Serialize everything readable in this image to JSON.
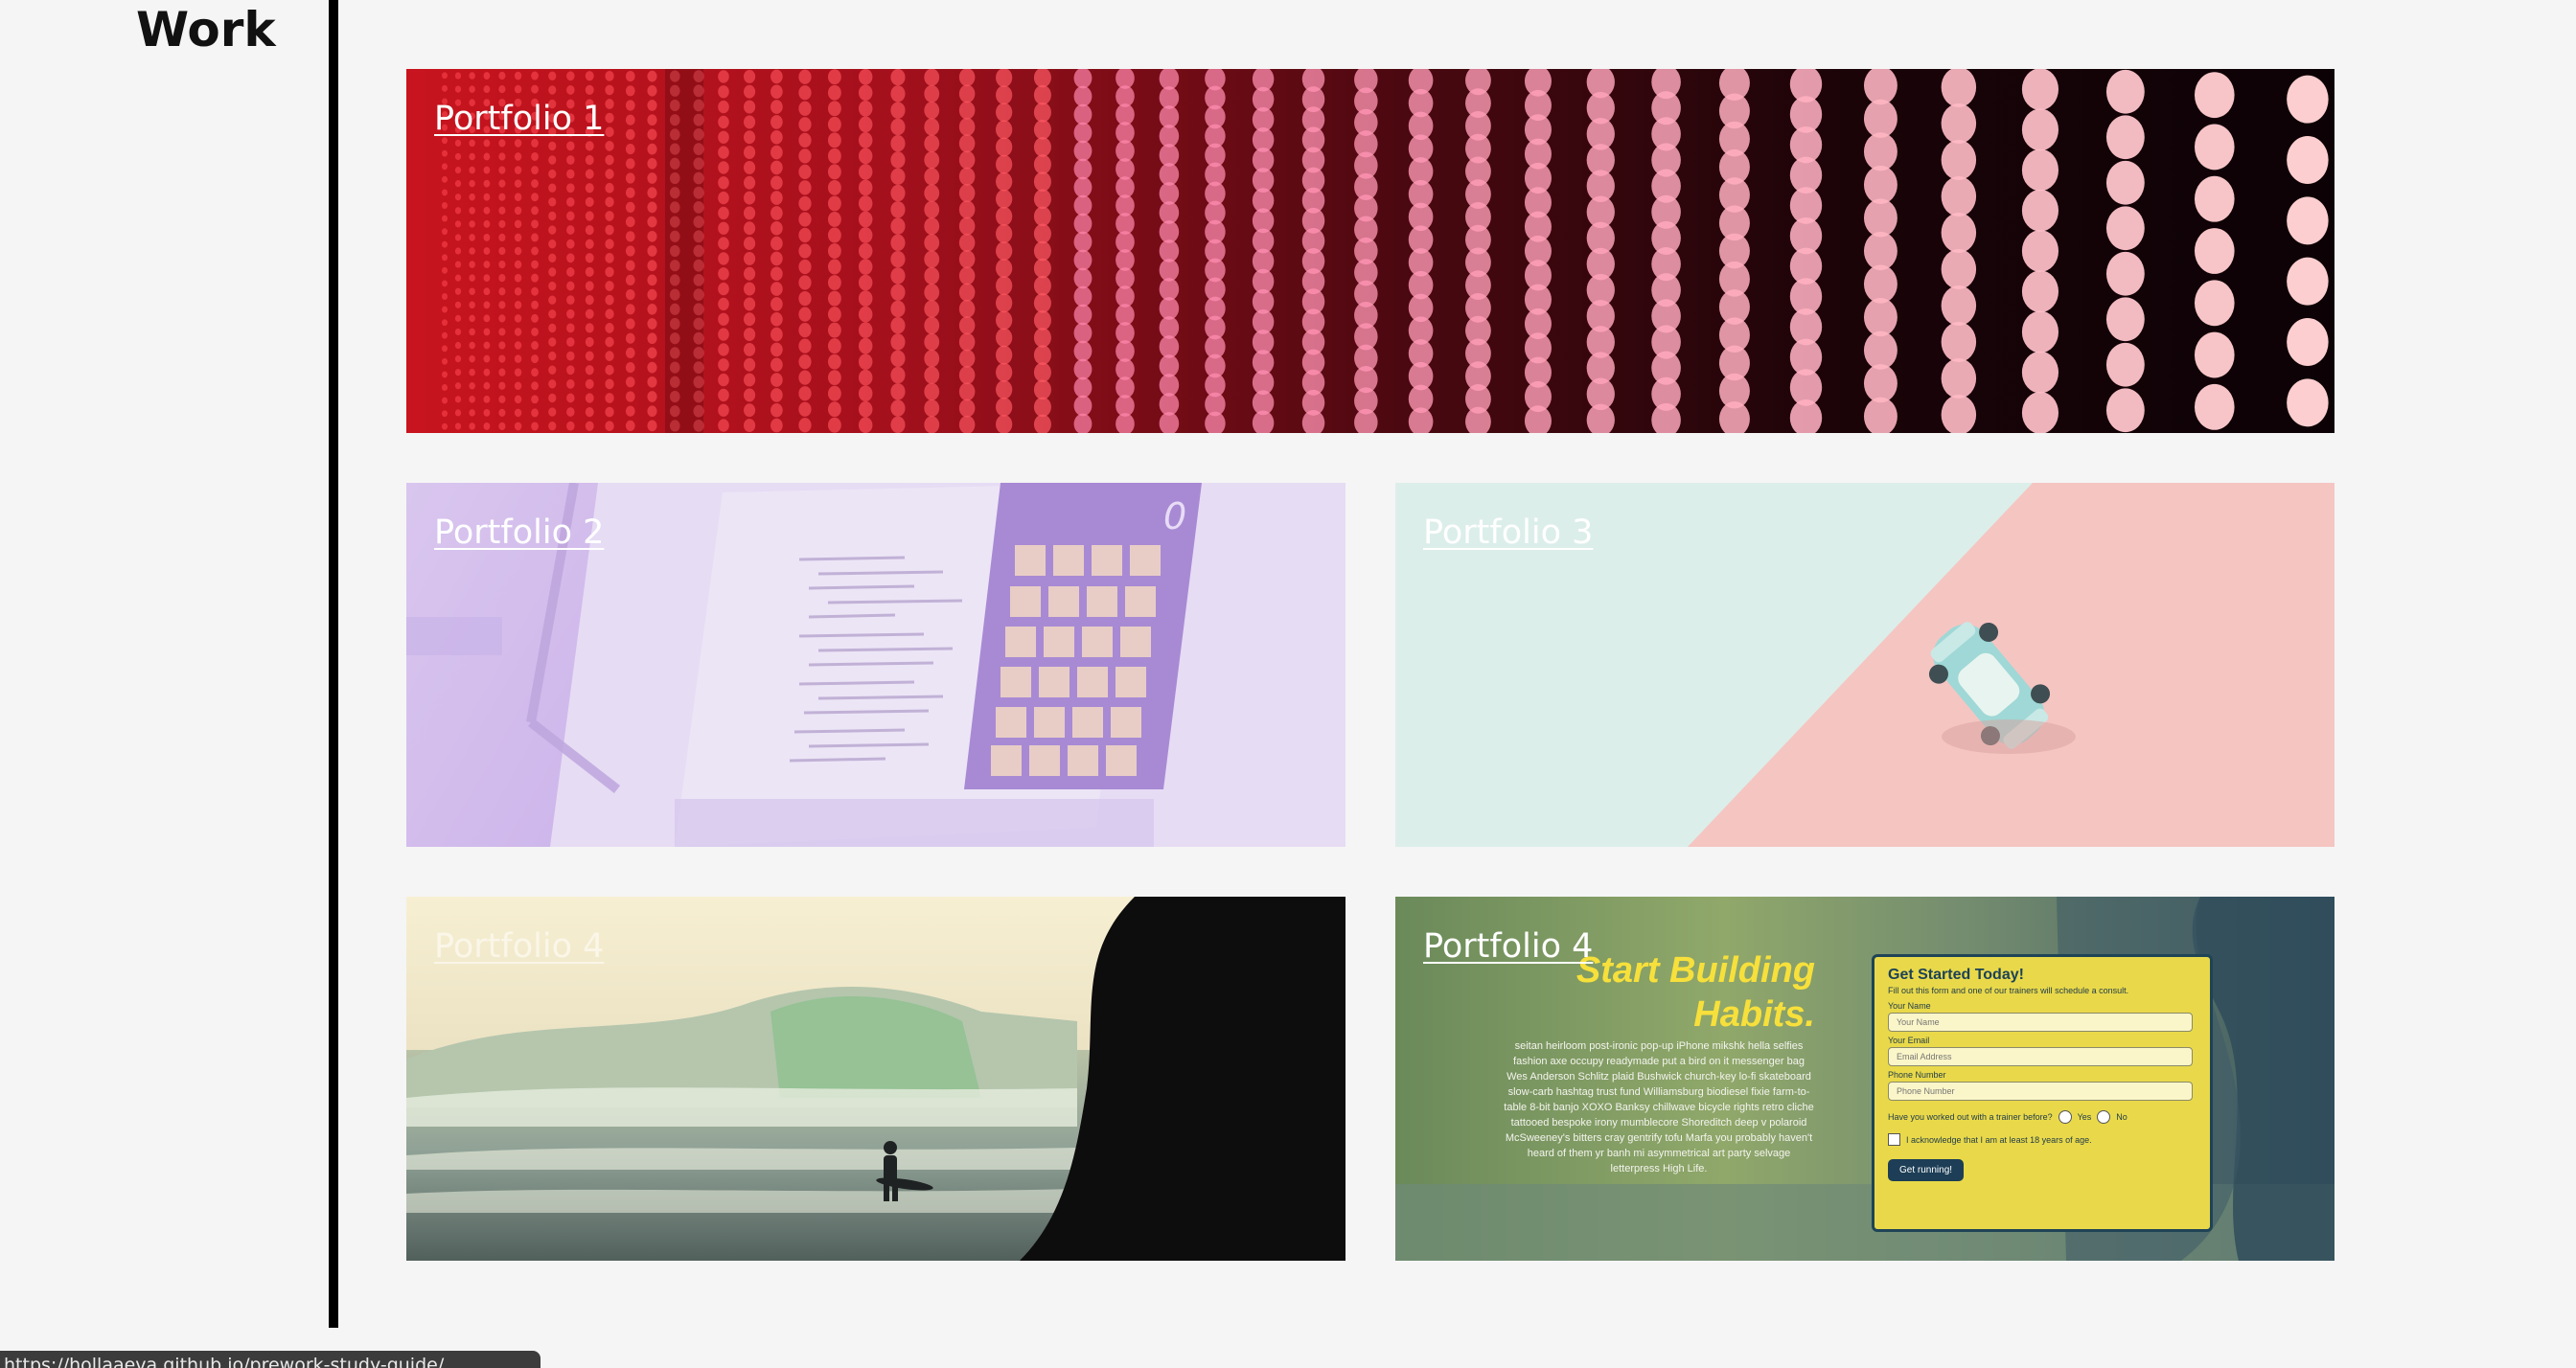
{
  "section": {
    "title": "Work"
  },
  "cards": [
    {
      "label": "Portfolio 1",
      "image": "led-light-wall"
    },
    {
      "label": "Portfolio 2",
      "image": "calculator-code-screen"
    },
    {
      "label": "Portfolio 3",
      "image": "toy-car-mint-pink"
    },
    {
      "label": "Portfolio 4",
      "image": "surfer-waves"
    },
    {
      "label": "Portfolio 4",
      "image": "fitness-site-screenshot"
    }
  ],
  "fitness": {
    "heading_1": "Start Building",
    "heading_2": "Habits.",
    "body": "seitan heirloom post-ironic pop-up iPhone mikshk hella selfies fashion axe occupy readymade put a bird on it messenger bag Wes Anderson Schlitz plaid Bushwick church-key lo-fi skateboard slow-carb hashtag trust fund Williamsburg biodiesel fixie farm-to-table 8-bit banjo XOXO Banksy chillwave bicycle rights retro cliche tattooed bespoke irony mumblecore Shoreditch deep v polaroid McSweeney's bitters cray gentrify tofu Marfa you probably haven't heard of them yr banh mi asymmetrical art party selvage letterpress High Life.",
    "form": {
      "title": "Get Started Today!",
      "subtitle": "Fill out this form and one of our trainers will schedule a consult.",
      "name_label": "Your Name",
      "name_placeholder": "Your Name",
      "email_label": "Your Email",
      "email_placeholder": "Email Address",
      "phone_label": "Phone Number",
      "phone_placeholder": "Phone Number",
      "question": "Have you worked out with a trainer before?",
      "yes": "Yes",
      "no": "No",
      "ack": "I acknowledge that I am at least 18 years of age.",
      "button": "Get running!"
    }
  },
  "calculator": {
    "display": "0"
  },
  "status_bar": {
    "url": "https://hollaaeva.github.io/prework-study-guide/"
  },
  "colors": {
    "background": "#f5f5f5",
    "divider": "#000000",
    "link": "#ffffff"
  }
}
